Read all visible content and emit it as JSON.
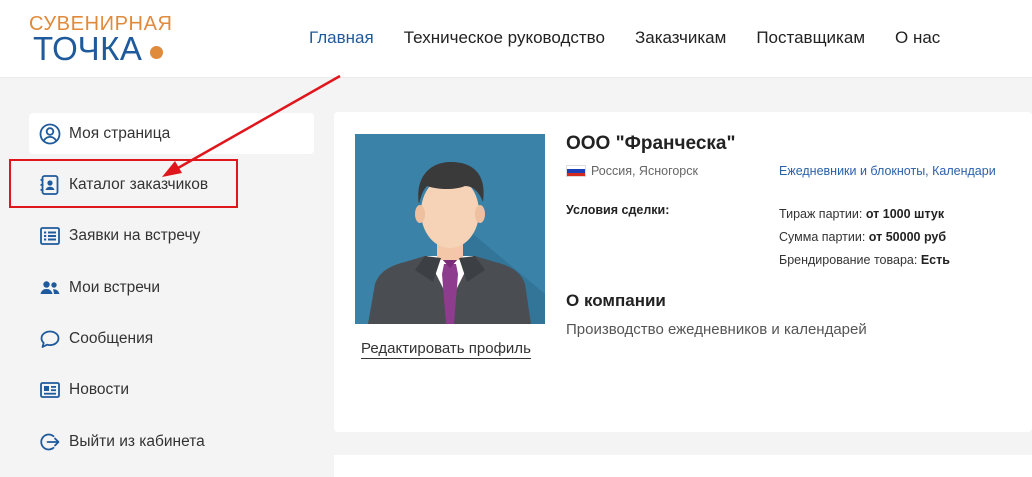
{
  "logo": {
    "top": "СУВЕНИРНАЯ",
    "bottom": "ТОЧКА"
  },
  "nav": [
    {
      "label": "Главная",
      "active": true
    },
    {
      "label": "Техническое руководство"
    },
    {
      "label": "Заказчикам"
    },
    {
      "label": "Поставщикам"
    },
    {
      "label": "О нас"
    }
  ],
  "sidebar": {
    "items": [
      {
        "label": "Моя страница",
        "icon": "user-circle-icon"
      },
      {
        "label": "Каталог заказчиков",
        "icon": "contact-book-icon"
      },
      {
        "label": "Заявки на встречу",
        "icon": "list-icon"
      },
      {
        "label": "Мои встречи",
        "icon": "users-icon"
      },
      {
        "label": "Сообщения",
        "icon": "chat-bubble-icon"
      },
      {
        "label": "Новости",
        "icon": "newspaper-icon"
      },
      {
        "label": "Выйти из кабинета",
        "icon": "logout-icon"
      }
    ]
  },
  "profile": {
    "company": "ООО \"Франческа\"",
    "location": "Россия, Ясногорск",
    "categories": "Ежедневники и блокноты, Календари",
    "deal_label": "Условия сделки:",
    "terms": [
      {
        "label": "Тираж партии:",
        "value": "от 1000 штук"
      },
      {
        "label": "Сумма партии:",
        "value": "от 50000 руб"
      },
      {
        "label": "Брендирование товара:",
        "value": "Есть"
      }
    ],
    "about_title": "О компании",
    "about_text": "Производство ежедневников и календарей",
    "edit_link": "Редактировать профиль"
  },
  "colors": {
    "brand_blue": "#1f5a9c",
    "brand_orange": "#e08a3c",
    "annotation_red": "#e0161d",
    "link_blue": "#2a62a8"
  }
}
